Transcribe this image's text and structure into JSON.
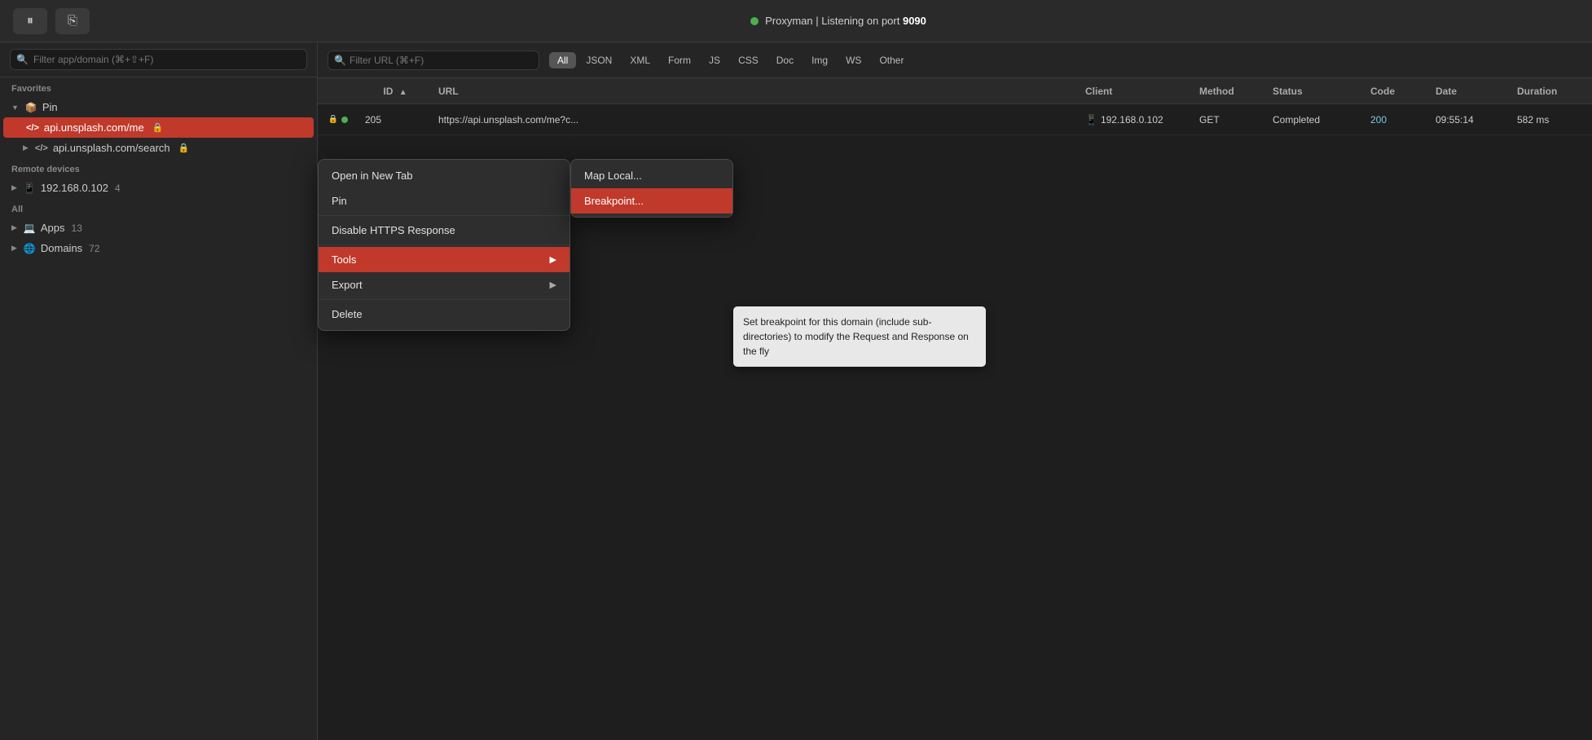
{
  "titlebar": {
    "status_dot_color": "#4caf50",
    "title_prefix": "Proxyman | Listening on port ",
    "port": "9090",
    "pause_label": "⏸",
    "edit_label": "✎"
  },
  "sidebar": {
    "search_placeholder": "Filter app/domain (⌘+⇧+F)",
    "favorites_label": "Favorites",
    "pin_label": "Pin",
    "pin_icon": "📦",
    "items": [
      {
        "label": "api.unsplash.com/me",
        "active": true,
        "has_lock": true,
        "icon": "</>"
      },
      {
        "label": "api.unsplash.com/search",
        "active": false,
        "has_lock": true,
        "icon": "</>"
      }
    ],
    "remote_devices_label": "Remote devices",
    "remote_device": "192.168.0.102",
    "remote_badge": "4",
    "all_label": "All",
    "apps_label": "Apps",
    "apps_badge": "13",
    "domains_label": "Domains",
    "domains_badge": "72"
  },
  "filter_bar": {
    "search_placeholder": "Filter URL (⌘+F)",
    "tabs": [
      "All",
      "JSON",
      "XML",
      "Form",
      "JS",
      "CSS",
      "Doc",
      "Img",
      "WS",
      "Other"
    ],
    "active_tab": "All"
  },
  "table": {
    "headers": [
      {
        "key": "id",
        "label": "ID",
        "sortable": true,
        "sort_dir": "asc"
      },
      {
        "key": "url",
        "label": "URL"
      },
      {
        "key": "client",
        "label": "Client"
      },
      {
        "key": "method",
        "label": "Method"
      },
      {
        "key": "status",
        "label": "Status"
      },
      {
        "key": "code",
        "label": "Code"
      },
      {
        "key": "date",
        "label": "Date"
      },
      {
        "key": "duration",
        "label": "Duration"
      }
    ],
    "rows": [
      {
        "id": "205",
        "url": "https://api.unsplash.com/me?c...",
        "client": "192.168.0.102",
        "client_icon": "📱",
        "method": "GET",
        "status": "Completed",
        "code": "200",
        "date": "09:55:14",
        "duration": "582 ms"
      }
    ]
  },
  "context_menu": {
    "items": [
      {
        "label": "Open in New Tab",
        "has_arrow": false
      },
      {
        "label": "Pin",
        "has_arrow": false
      },
      {
        "label": "Disable HTTPS Response",
        "has_arrow": false
      },
      {
        "label": "Tools",
        "has_arrow": true,
        "highlighted": true
      },
      {
        "label": "Export",
        "has_arrow": true,
        "highlighted": false
      },
      {
        "label": "Delete",
        "has_arrow": false
      }
    ]
  },
  "submenu": {
    "items": [
      {
        "label": "Map Local...",
        "highlighted": false
      },
      {
        "label": "Breakpoint...",
        "highlighted": true
      }
    ]
  },
  "tooltip": {
    "text": "Set breakpoint for this domain (include sub-directories) to modify the Request and Response on the fly"
  }
}
